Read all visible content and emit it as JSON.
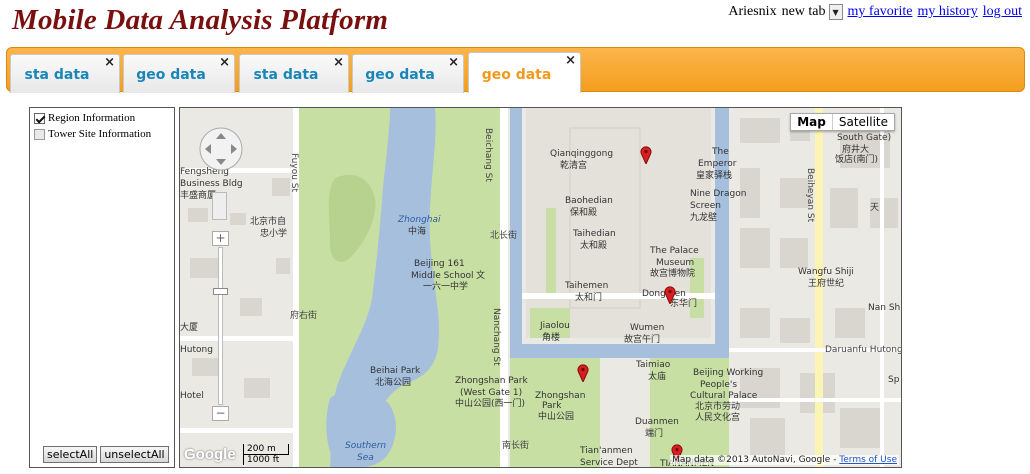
{
  "header": {
    "title": "Mobile Data Analysis Platform",
    "username": "Ariesnix",
    "new_tab_label": "new tab",
    "links": {
      "favorite": "my favorite",
      "history": "my history",
      "logout": "log out"
    }
  },
  "tabs": [
    {
      "label": "sta data",
      "active": false
    },
    {
      "label": "geo data",
      "active": false
    },
    {
      "label": "sta data",
      "active": false
    },
    {
      "label": "geo data",
      "active": false
    },
    {
      "label": "geo data",
      "active": true
    }
  ],
  "tab_close_glyph": "×",
  "layers_panel": {
    "options": [
      {
        "label": "Region Information",
        "checked": true
      },
      {
        "label": "Tower Site Information",
        "checked": false
      }
    ],
    "select_all_label": "selectAll",
    "unselect_all_label": "unselectAll"
  },
  "map": {
    "type_buttons": {
      "map": "Map",
      "satellite": "Satellite"
    },
    "selected_type": "Map",
    "zoom_in": "+",
    "zoom_out": "−",
    "scale": {
      "metric": "200 m",
      "imperial": "1000 ft"
    },
    "logo": "Google",
    "attribution": "Map data ©2013 AutoNavi, Google - ",
    "terms_link": "Terms of Use",
    "labels": {
      "qianqinggong": "Qianqinggong",
      "qianqinggong_cn": "乾清宫",
      "emperor_1": "The",
      "emperor_2": "Emperor",
      "emperor_cn": "皇家驿栈",
      "southgate": "South Gate)",
      "southgate_cn": "府井大",
      "southgate_cn2": "饭店(南门)",
      "baohedian": "Baohedian",
      "baohedian_cn": "保和殿",
      "ninedragon_1": "Nine Dragon",
      "ninedragon_2": "Screen",
      "ninedragon_cn": "九龙壁",
      "taihedian": "Taihedian",
      "taihedian_cn": "太和殿",
      "palace_1": "The Palace",
      "palace_2": "Museum",
      "palace_cn": "故宫博物院",
      "taihemen": "Taihemen",
      "taihemen_cn": "太和门",
      "dongmen": "Dongmen",
      "dongmen_cn": "东华门",
      "wangfu": "Wangfu Shiji",
      "wangfu_cn": "王府世纪",
      "jiaolou": "Jiaolou",
      "jiaolou_cn": "角楼",
      "wumen": "Wumen",
      "wumen_cn": "故宫午门",
      "beihai": "Beihai Park",
      "beihai_cn": "北海公园",
      "zhongshan_w": "Zhongshan Park",
      "zhongshan_w2": "(West Gate 1)",
      "zhongshan_w_cn": "中山公园(西一门)",
      "zhongshan": "Zhongshan",
      "zhongshan2": "Park",
      "zhongshan_cn": "中山公园",
      "taimiao": "Taimiao",
      "taimiao_cn": "太庙",
      "workers_1": "Beijing Working",
      "workers_2": "People's",
      "workers_3": "Cultural Palace",
      "workers_cn": "北京市劳动",
      "workers_cn2": "人民文化宫",
      "duanmen": "Duanmen",
      "duanmen_cn": "端门",
      "tiananmen_1": "Tian'anmen",
      "tiananmen_2": "Service Dept",
      "tiananmen_cn": "TIANANMEN",
      "zhonghai": "Zhonghai",
      "zhonghai_cn": "中海",
      "school_1": "Beijing 161",
      "school_2": "Middle School",
      "school_cn": "一六一中学",
      "southern_sea": "Southern",
      "southern_sea2": "Sea",
      "fengsheng_1": "Fengsheng",
      "fengsheng_2": "Business Bldg",
      "fengsheng_cn": "丰盛商厦",
      "bjzi": "北京市自",
      "bjzi2": "忠小学",
      "dasha": "大厦",
      "hutong": "Hutong",
      "hotel": "Hotel",
      "fuyou": "Fuyou St",
      "beichang": "Beichang St",
      "nanchang": "Nanchang St",
      "beichang_cn": "北长街",
      "nanchang_cn": "南长街",
      "fuyou_cn": "府右街",
      "beiheyan": "Beiheyan St",
      "daruanfu": "Daruanfu Hutong",
      "dongdan_cn": "北京市",
      "tianm": "天",
      "nan_sh": "Nan Sh",
      "sp": "Sp",
      "wen_cn": "文"
    }
  }
}
